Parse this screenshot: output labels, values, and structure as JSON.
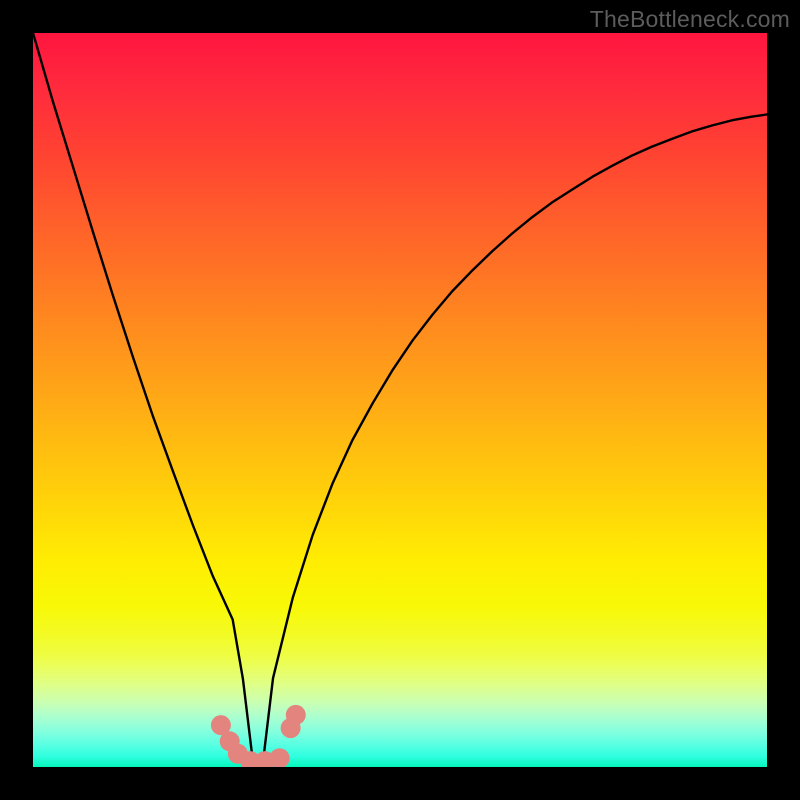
{
  "watermark": "TheBottleneck.com",
  "chart_data": {
    "type": "line",
    "title": "",
    "xlabel": "",
    "ylabel": "",
    "xlim": [
      0,
      100
    ],
    "ylim": [
      0,
      100
    ],
    "background": "rainbow-gradient",
    "series": [
      {
        "name": "bottleneck-curve",
        "x": [
          0,
          2.7,
          5.5,
          8.2,
          10.9,
          13.6,
          16.3,
          19.1,
          21.8,
          24.5,
          27.2,
          28.6,
          30.0,
          31.3,
          32.7,
          35.4,
          38.1,
          40.8,
          43.5,
          46.3,
          49.0,
          51.7,
          54.4,
          57.1,
          59.9,
          62.6,
          65.3,
          68.0,
          70.7,
          73.5,
          76.2,
          78.9,
          81.6,
          84.3,
          87.1,
          89.8,
          92.5,
          95.2,
          97.9,
          100
        ],
        "y": [
          100,
          90.7,
          81.6,
          72.8,
          64.2,
          55.9,
          47.9,
          40.2,
          32.9,
          26.0,
          20.1,
          12.0,
          0.41,
          0.41,
          12.1,
          23.1,
          31.6,
          38.6,
          44.5,
          49.6,
          54.1,
          58.1,
          61.6,
          64.8,
          67.7,
          70.3,
          72.7,
          74.9,
          76.9,
          78.7,
          80.4,
          81.9,
          83.3,
          84.5,
          85.6,
          86.6,
          87.4,
          88.1,
          88.6,
          88.9
        ]
      }
    ],
    "markers": [
      {
        "name": "highlight-dot",
        "x": 25.6,
        "y": 5.7
      },
      {
        "name": "highlight-dot",
        "x": 26.8,
        "y": 3.5
      },
      {
        "name": "highlight-dot",
        "x": 27.9,
        "y": 1.8
      },
      {
        "name": "highlight-dot",
        "x": 29.6,
        "y": 0.8
      },
      {
        "name": "highlight-dot",
        "x": 31.6,
        "y": 0.8
      },
      {
        "name": "highlight-dot",
        "x": 33.6,
        "y": 1.2
      },
      {
        "name": "highlight-dot",
        "x": 35.1,
        "y": 5.3
      },
      {
        "name": "highlight-dot",
        "x": 35.8,
        "y": 7.1
      }
    ]
  }
}
